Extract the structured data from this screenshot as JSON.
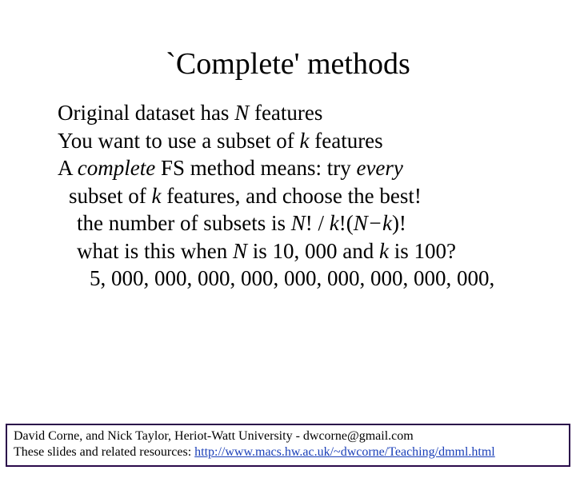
{
  "title": "`Complete' methods",
  "body": {
    "l1a": "Original dataset has ",
    "l1b": "N",
    "l1c": " features",
    "l2a": "You want to use a subset of ",
    "l2b": "k",
    "l2c": " features",
    "l3a": "A ",
    "l3b": "complete",
    "l3c": " FS method means:  try ",
    "l3d": "every",
    "l4a": "subset of ",
    "l4b": "k",
    "l4c": " features, and choose the best!",
    "l5a": "the number of subsets is ",
    "l5b": "N",
    "l5c": "! / ",
    "l5d": "k",
    "l5e": "!(",
    "l5f": "N−k",
    "l5g": ")!",
    "l6a": "what is this when ",
    "l6b": "N",
    "l6c": " is 10, 000 and ",
    "l6d": "k",
    "l6e": " is 100?",
    "l7": "5, 000, 000, 000, 000, 000, 000, 000, 000, 000,"
  },
  "footer": {
    "line1": "David Corne, and Nick Taylor,  Heriot-Watt University  -  dwcorne@gmail.com",
    "line2a": "These slides and related resources:  ",
    "line2b": "http://www.macs.hw.ac.uk/~dwcorne/Teaching/dmml.html"
  }
}
